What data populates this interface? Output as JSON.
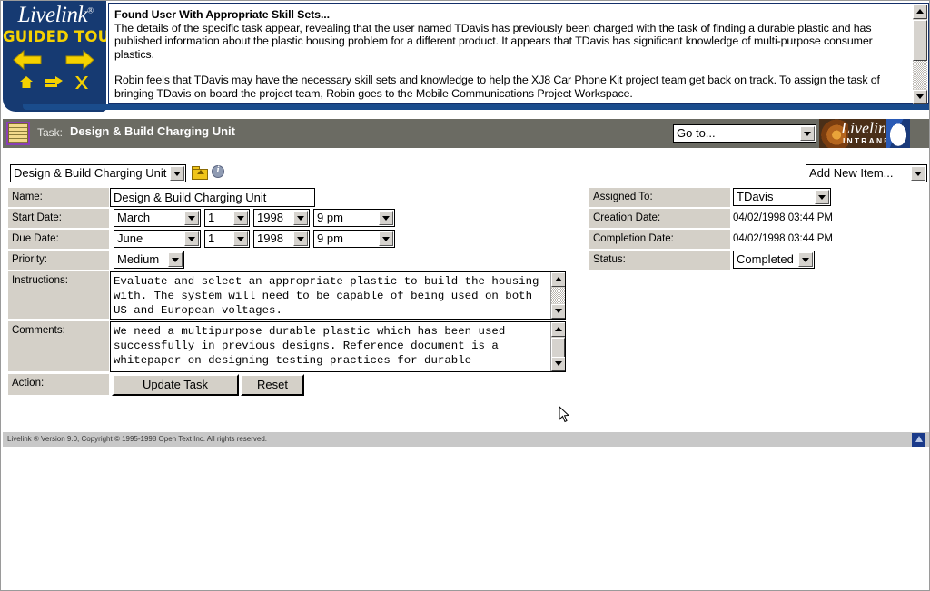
{
  "tour": {
    "logo_name": "Livelink",
    "logo_reg": "®",
    "subtitle": "GUIDED TOUR",
    "nav": {
      "back": "⬅",
      "forward": "➡",
      "home": "⌂",
      "skip": "↦",
      "close": "✕"
    },
    "heading": "Found User With Appropriate Skill Sets...",
    "paragraph1": "The details of the specific task appear, revealing that the user named TDavis has previously been charged with the task of finding a durable plastic and has published information about the plastic housing problem for a different product. It appears that TDavis has significant knowledge of multi-purpose consumer plastics.",
    "paragraph2": "Robin feels that TDavis may have the necessary skill sets and knowledge to help the XJ8 Car Phone Kit project team get back on track. To assign the task of bringing TDavis on board the project team, Robin goes to the Mobile Communications Project Workspace."
  },
  "taskbar": {
    "icon": "notepad-icon",
    "label": "Task:",
    "title": "Design & Build Charging Unit",
    "goto_value": "Go to...",
    "logo_word": "Livelink",
    "logo_sub": "INTRANET"
  },
  "toolbar": {
    "object_select": "Design & Build Charging Unit",
    "folder_icon": "up-folder-icon",
    "info_icon": "info-icon",
    "add_new_item": "Add New Item..."
  },
  "form": {
    "name_label": "Name:",
    "name_value": "Design & Build Charging Unit",
    "start_date_label": "Start Date:",
    "start_month": "March",
    "start_day": "1",
    "start_year": "1998",
    "start_time": "9 pm",
    "due_date_label": "Due Date:",
    "due_month": "June",
    "due_day": "1",
    "due_year": "1998",
    "due_time": "9 pm",
    "priority_label": "Priority:",
    "priority_value": "Medium",
    "instructions_label": "Instructions:",
    "instructions_value": "Evaluate and select an appropriate plastic to build the housing with. The system will need to be capable of being used on both US and European voltages.",
    "comments_label": "Comments:",
    "comments_value": "We need a multipurpose durable plastic which has been used successfully in previous designs. Reference document is a whitepaper on designing testing practices for durable",
    "action_label": "Action:",
    "update_button": "Update Task",
    "reset_button": "Reset"
  },
  "details": {
    "assigned_to_label": "Assigned To:",
    "assigned_to_value": "TDavis",
    "creation_date_label": "Creation Date:",
    "creation_date_value": "04/02/1998 03:44 PM",
    "completion_date_label": "Completion Date:",
    "completion_date_value": "04/02/1998 03:44 PM",
    "status_label": "Status:",
    "status_value": "Completed"
  },
  "footer": {
    "copyright": "Livelink ® Version 9.0, Copyright © 1995-1998 Open Text Inc. All rights reserved.",
    "up_icon": "back-to-top-icon"
  },
  "colors": {
    "tour_blue": "#163a72",
    "tour_yellow": "#f5d100",
    "taskbar_gray": "#6b6b63",
    "form_label_gray": "#d4d0c8"
  }
}
